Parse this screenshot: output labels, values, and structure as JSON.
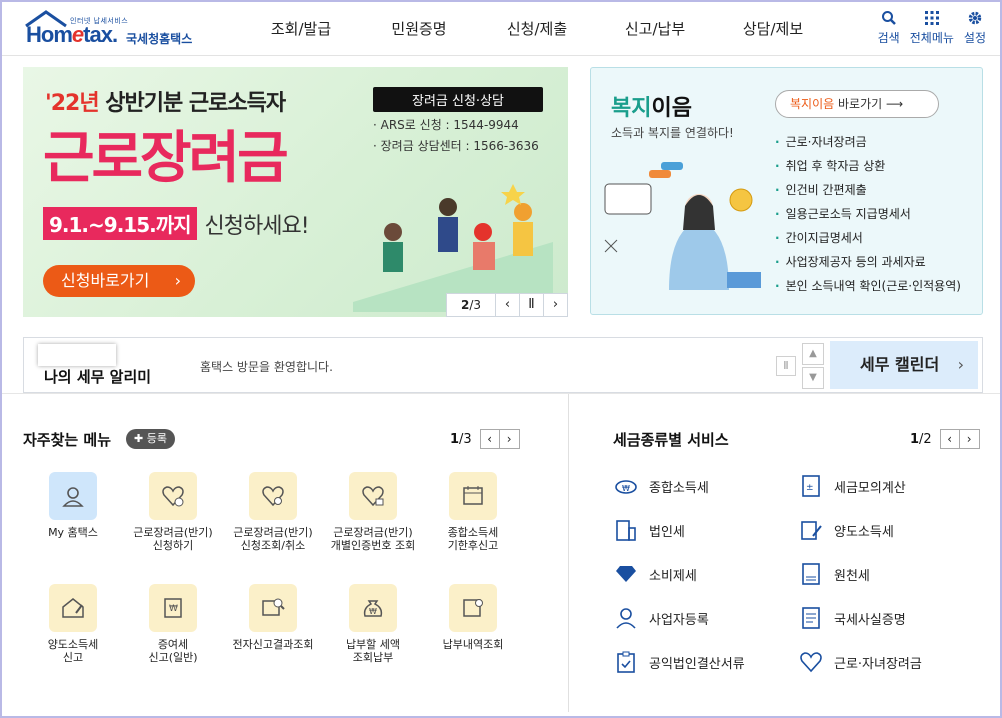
{
  "header": {
    "logo_sub": "인터넷 납세서비스",
    "logo_brand_a": "Hom",
    "logo_brand_e": "e",
    "logo_brand_b": "tax.",
    "logo_kr": "국세청홈택스",
    "nav": [
      "조회/발급",
      "민원증명",
      "신청/제출",
      "신고/납부",
      "상담/제보"
    ],
    "util": {
      "search": "검색",
      "menu": "전체메뉴",
      "settings": "설정"
    }
  },
  "main_banner": {
    "title_year": "'22년",
    "title_rest": " 상반기분 근로소득자",
    "big_title": "근로장려금",
    "date": "9.1.~9.15.까지",
    "date_tail": "신청하세요!",
    "apply_button": "신청바로가기",
    "info_tag": "장려금 신청·상담",
    "info_line1": "· ARS로 신청 : 1544-9944",
    "info_line2": "· 장려금 상담센터 : 1566-3636",
    "page_current": "2",
    "page_total": "/3"
  },
  "welfare": {
    "title_a": "복지",
    "title_b": "이음",
    "subtitle": "소득과 복지를 연결하다!",
    "button_a": "복지이음",
    "button_b": " 바로가기",
    "items": [
      "근로·자녀장려금",
      "취업 후 학자금 상환",
      "인건비 간편제출",
      "일용근로소득 지급명세서",
      "간이지급명세서",
      "사업장제공자 등의 과세자료",
      "본인 소득내역 확인(근로·인적용역)"
    ]
  },
  "notice": {
    "title": "나의 세무 알리미",
    "message": "홈택스 방문을 환영합니다.",
    "calendar_button": "세무 캘린더"
  },
  "quick_menu": {
    "title": "자주찾는 메뉴",
    "register": "등록",
    "page_current": "1",
    "page_total": "/3",
    "items": [
      {
        "label": "My 홈택스",
        "icon": "user-icon"
      },
      {
        "label": "근로장려금(반기)\n신청하기",
        "icon": "heart-coin-icon"
      },
      {
        "label": "근로장려금(반기)\n신청조회/취소",
        "icon": "heart-search-icon"
      },
      {
        "label": "근로장려금(반기)\n개별인증번호 조회",
        "icon": "heart-key-icon"
      },
      {
        "label": "종합소득세\n기한후신고",
        "icon": "calendar-doc-icon"
      },
      {
        "label": "양도소득세\n신고",
        "icon": "house-pen-icon"
      },
      {
        "label": "증여세\n신고(일반)",
        "icon": "gift-doc-icon"
      },
      {
        "label": "전자신고결과조회",
        "icon": "doc-search-icon"
      },
      {
        "label": "납부할 세액\n조회납부",
        "icon": "money-bag-icon"
      },
      {
        "label": "납부내역조회",
        "icon": "receipt-search-icon"
      }
    ]
  },
  "tax_services": {
    "title": "세금종류별 서비스",
    "page_current": "1",
    "page_total": "/2",
    "items": [
      {
        "label": "종합소득세",
        "icon": "car-coin-icon"
      },
      {
        "label": "세금모의계산",
        "icon": "calculator-icon"
      },
      {
        "label": "법인세",
        "icon": "building-icon"
      },
      {
        "label": "양도소득세",
        "icon": "contract-pen-icon"
      },
      {
        "label": "소비제세",
        "icon": "diamond-icon"
      },
      {
        "label": "원천세",
        "icon": "salary-doc-icon"
      },
      {
        "label": "사업자등록",
        "icon": "person-icon"
      },
      {
        "label": "국세사실증명",
        "icon": "certificate-icon"
      },
      {
        "label": "공익법인결산서류",
        "icon": "clipboard-check-icon"
      },
      {
        "label": "근로·자녀장려금",
        "icon": "heart-hands-icon"
      }
    ]
  },
  "colors": {
    "brand_blue": "#1a4fa0",
    "accent_pink": "#e8295d",
    "accent_orange": "#ec5a16",
    "teal": "#1a9e8c"
  }
}
